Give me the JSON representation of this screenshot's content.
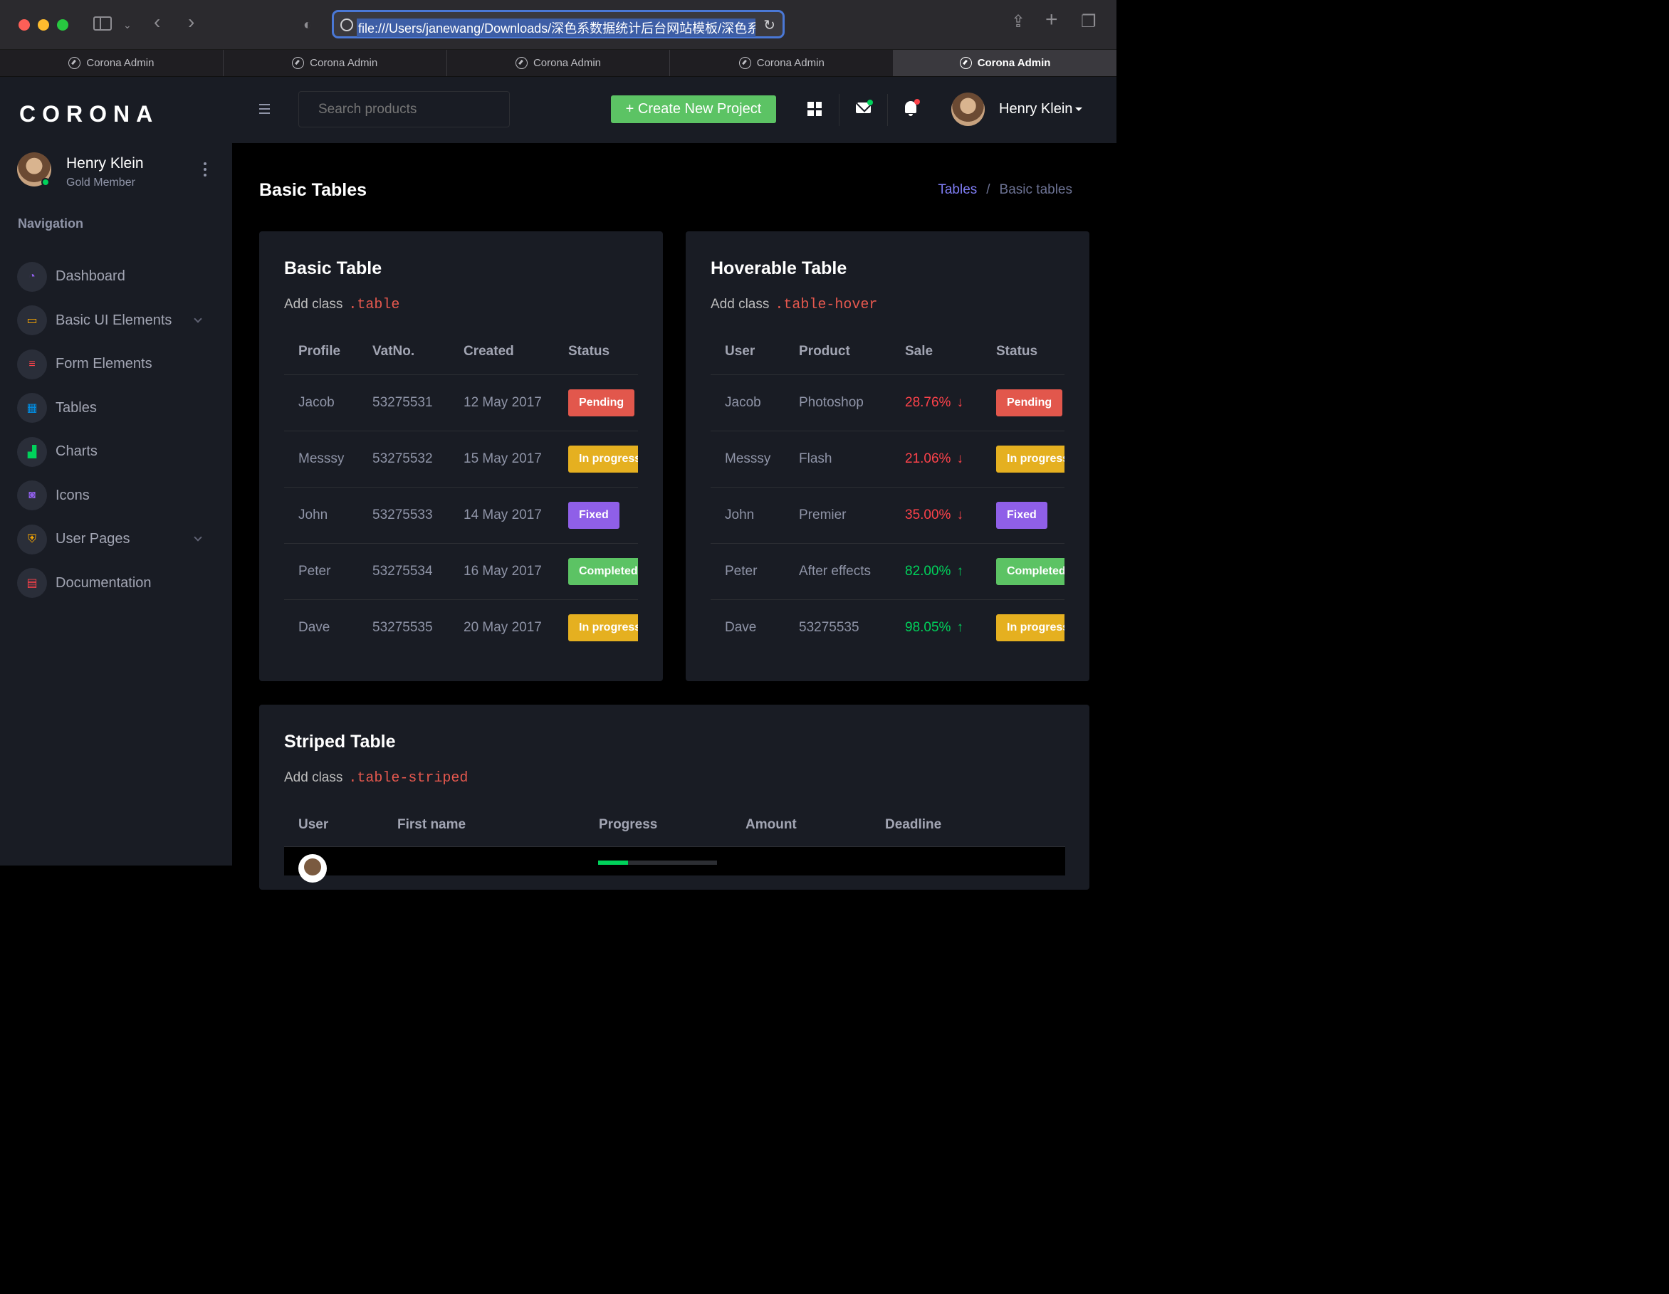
{
  "browser": {
    "url": "file:///Users/janewang/Downloads/深色系数据统计后台网站模板/深色系",
    "tabs": [
      "Corona Admin",
      "Corona Admin",
      "Corona Admin",
      "Corona Admin",
      "Corona Admin"
    ],
    "active_tab": 4
  },
  "sidebar": {
    "brand": "CORONA",
    "profile": {
      "name": "Henry Klein",
      "tier": "Gold Member"
    },
    "nav_heading": "Navigation",
    "items": [
      {
        "label": "Dashboard",
        "icon": "speedometer-icon",
        "color": "#8f5fe8"
      },
      {
        "label": "Basic UI Elements",
        "icon": "laptop-icon",
        "color": "#ffab00"
      },
      {
        "label": "Form Elements",
        "icon": "list-icon",
        "color": "#fc424a"
      },
      {
        "label": "Tables",
        "icon": "table-icon",
        "color": "#0090e7"
      },
      {
        "label": "Charts",
        "icon": "bar-chart-icon",
        "color": "#00d25b"
      },
      {
        "label": "Icons",
        "icon": "contacts-icon",
        "color": "#8f5fe8"
      },
      {
        "label": "User Pages",
        "icon": "security-icon",
        "color": "#ffab00"
      },
      {
        "label": "Documentation",
        "icon": "file-document-icon",
        "color": "#fc424a"
      }
    ]
  },
  "topbar": {
    "search_placeholder": "Search products",
    "create_label": "+ Create New Project",
    "user_name": "Henry Klein"
  },
  "page": {
    "title": "Basic Tables",
    "breadcrumb": {
      "link": "Tables",
      "separator": "/",
      "current": "Basic tables"
    }
  },
  "basic_table": {
    "title": "Basic Table",
    "desc": "Add class",
    "code": ".table",
    "headers": [
      "Profile",
      "VatNo.",
      "Created",
      "Status"
    ],
    "rows": [
      {
        "profile": "Jacob",
        "vat": "53275531",
        "created": "12 May 2017",
        "status": "Pending",
        "status_color": "#e2574c"
      },
      {
        "profile": "Messsy",
        "vat": "53275532",
        "created": "15 May 2017",
        "status": "In progress",
        "status_color": "#e5b020"
      },
      {
        "profile": "John",
        "vat": "53275533",
        "created": "14 May 2017",
        "status": "Fixed",
        "status_color": "#8f5fe8"
      },
      {
        "profile": "Peter",
        "vat": "53275534",
        "created": "16 May 2017",
        "status": "Completed",
        "status_color": "#5cc364"
      },
      {
        "profile": "Dave",
        "vat": "53275535",
        "created": "20 May 2017",
        "status": "In progress",
        "status_color": "#e5b020"
      }
    ]
  },
  "hover_table": {
    "title": "Hoverable Table",
    "desc": "Add class",
    "code": ".table-hover",
    "headers": [
      "User",
      "Product",
      "Sale",
      "Status"
    ],
    "rows": [
      {
        "user": "Jacob",
        "product": "Photoshop",
        "sale": "28.76%",
        "arrow": "↓",
        "sale_color": "#fc424a",
        "status": "Pending",
        "status_color": "#e2574c"
      },
      {
        "user": "Messsy",
        "product": "Flash",
        "sale": "21.06%",
        "arrow": "↓",
        "sale_color": "#fc424a",
        "status": "In progress",
        "status_color": "#e5b020"
      },
      {
        "user": "John",
        "product": "Premier",
        "sale": "35.00%",
        "arrow": "↓",
        "sale_color": "#fc424a",
        "status": "Fixed",
        "status_color": "#8f5fe8"
      },
      {
        "user": "Peter",
        "product": "After effects",
        "sale": "82.00%",
        "arrow": "↑",
        "sale_color": "#00d25b",
        "status": "Completed",
        "status_color": "#5cc364"
      },
      {
        "user": "Dave",
        "product": "53275535",
        "sale": "98.05%",
        "arrow": "↑",
        "sale_color": "#00d25b",
        "status": "In progress",
        "status_color": "#e5b020"
      }
    ]
  },
  "striped_table": {
    "title": "Striped Table",
    "desc": "Add class",
    "code": ".table-striped",
    "headers": [
      "User",
      "First name",
      "Progress",
      "Amount",
      "Deadline"
    ],
    "first_row_progress": 0.25
  }
}
